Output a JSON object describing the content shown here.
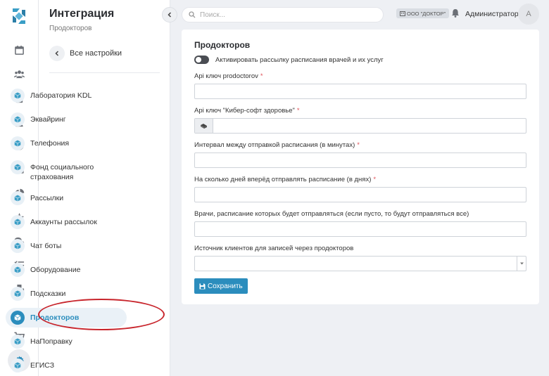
{
  "rail": {
    "icons": [
      "calendar-icon",
      "users-icon",
      "clipboard-icon",
      "doctor-icon",
      "clock-icon",
      "table-icon",
      "pie-chart-icon",
      "star-icon",
      "chat-icon",
      "checklist-icon",
      "boxes-icon",
      "cart-icon",
      "cart-plus-icon",
      "settings-icon"
    ],
    "active": "settings-icon"
  },
  "panel": {
    "title": "Интеграция",
    "subtitle": "Продокторов",
    "back_label": "Все настройки",
    "items": [
      {
        "label": "Лаборатория KDL"
      },
      {
        "label": "Эквайринг"
      },
      {
        "label": "Телефония"
      },
      {
        "label": "Фонд социального страхования"
      },
      {
        "label": "Рассылки"
      },
      {
        "label": "Аккаунты рассылок"
      },
      {
        "label": "Чат боты"
      },
      {
        "label": "Оборудование"
      },
      {
        "label": "Подсказки"
      },
      {
        "label": "Продокторов"
      },
      {
        "label": "НаПоправку"
      },
      {
        "label": "ЕГИСЗ"
      }
    ],
    "active_item": "Продокторов"
  },
  "topbar": {
    "search_placeholder": "Поиск...",
    "org_label": "ООО \"ДОКТОР\"",
    "user_name": "Администратор",
    "avatar_letter": "А"
  },
  "form": {
    "title": "Продокторов",
    "toggle_label": "Активировать рассылку расписания врачей и их услуг",
    "toggle_on": false,
    "fields": [
      {
        "label": "Api ключ prodoctorov",
        "required": true,
        "value": ""
      },
      {
        "label": "Api ключ \"Кибер-софт здоровье\"",
        "required": true,
        "value": ""
      },
      {
        "label": "Интервал между отправкой расписания (в минутах)",
        "required": true,
        "value": ""
      },
      {
        "label": "На сколько дней вперёд отправлять расписание (в днях)",
        "required": true,
        "value": ""
      },
      {
        "label": "Врачи, расписание которых будет отправляться (если пусто, то будут отправляться все)",
        "required": false,
        "value": ""
      },
      {
        "label": "Источник клиентов для записей через продокторов",
        "required": false,
        "value": ""
      }
    ],
    "required_mark": "*",
    "save_label": "Сохранить"
  },
  "colors": {
    "accent": "#2b8dbd",
    "required": "#e0525a",
    "annotation": "#c8252c"
  }
}
